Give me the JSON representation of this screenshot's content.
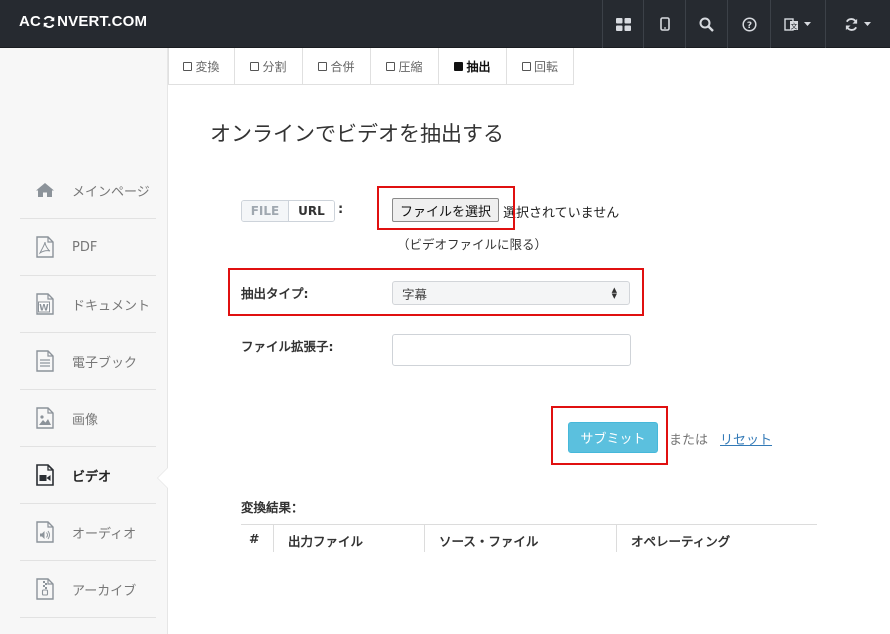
{
  "header": {
    "brand_prefix": "AC",
    "brand_suffix": "NVERT.COM",
    "buttons": [
      {
        "icon": "grid-icon"
      },
      {
        "icon": "mobile-icon"
      },
      {
        "icon": "search-icon"
      },
      {
        "icon": "help-icon"
      },
      {
        "icon": "language-icon"
      },
      {
        "icon": "refresh-icon"
      }
    ]
  },
  "sidebar": {
    "items": [
      {
        "label": "メインページ",
        "icon": "home-icon"
      },
      {
        "label": "PDF",
        "icon": "pdf-icon"
      },
      {
        "label": "ドキュメント",
        "icon": "word-icon"
      },
      {
        "label": "電子ブック",
        "icon": "ebook-icon"
      },
      {
        "label": "画像",
        "icon": "image-icon"
      },
      {
        "label": "ビデオ",
        "icon": "video-icon",
        "active": true
      },
      {
        "label": "オーディオ",
        "icon": "audio-icon"
      },
      {
        "label": "アーカイブ",
        "icon": "archive-icon"
      }
    ]
  },
  "tabs": [
    {
      "label": "変換"
    },
    {
      "label": "分割"
    },
    {
      "label": "合併"
    },
    {
      "label": "圧縮"
    },
    {
      "label": "抽出",
      "active": true
    },
    {
      "label": "回転"
    }
  ],
  "main": {
    "title": "オンラインでビデオを抽出する",
    "source_toggle": {
      "file": "FILE",
      "url": "URL",
      "colon": ":"
    },
    "file_input": {
      "button_label": "ファイルを選択",
      "status": "選択されていません",
      "hint": "（ビデオファイルに限る）"
    },
    "extract_type": {
      "label": "抽出タイプ:",
      "selected": "字幕"
    },
    "extension": {
      "label": "ファイル拡張子:",
      "value": ""
    },
    "submit_label": "サブミット",
    "or_label": "または",
    "reset_label": "リセット"
  },
  "results": {
    "title": "変換結果：",
    "columns": [
      "#",
      "出力ファイル",
      "ソース・ファイル",
      "オペレーティング"
    ]
  },
  "colors": {
    "navbar": "#262a30",
    "submit": "#5bc0de",
    "link": "#337ab7",
    "highlight_box": "#e01010"
  }
}
